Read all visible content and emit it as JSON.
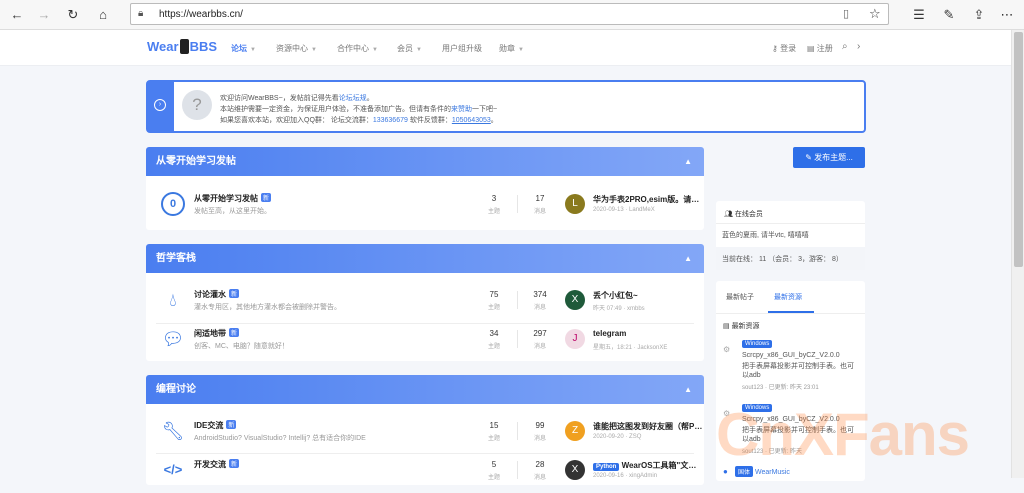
{
  "browser": {
    "url": "https://wearbbs.cn/"
  },
  "logo": {
    "text_a": "Wear",
    "text_b": "BBS"
  },
  "nav": {
    "items": [
      {
        "label": "论坛",
        "caret": true
      },
      {
        "label": "资源中心",
        "caret": true
      },
      {
        "label": "合作中心",
        "caret": true
      },
      {
        "label": "会员",
        "caret": true
      },
      {
        "label": "用户组升级",
        "caret": false
      },
      {
        "label": "勋章",
        "caret": true
      }
    ],
    "login": "登录",
    "register": "注册"
  },
  "notice": {
    "line1_a": "欢迎访问WearBBS~，发帖前记得先看",
    "line1_link": "论坛坛规",
    "line1_b": "。",
    "line2_a": "本站维护需要一定资金，为保证用户体验，不准备添加广告。但请有条件的",
    "line2_link": "来赞助",
    "line2_b": "一下吧~",
    "line3_a": "如果您喜欢本站，欢迎加入QQ群：  论坛交流群：",
    "line3_link1": "133636679",
    "line3_b": "  软件反馈群：",
    "line3_link2": "1050643053",
    "line3_c": "。"
  },
  "sections": [
    {
      "title": "从零开始学习发帖",
      "forums": [
        {
          "name": "从零开始学习发帖",
          "badge": "新",
          "desc": "发帖至高，从这里开始。",
          "threads": "3",
          "threads_label": "主题",
          "posts": "17",
          "posts_label": "消息",
          "last_title": "华为手表2PRO,esim版。请…",
          "last_meta": "2020-09-13 · LandMeX",
          "avatar": "L"
        }
      ]
    },
    {
      "title": "哲学客栈",
      "forums": [
        {
          "name": "讨论灌水",
          "badge": "新",
          "desc": "灌水专用区，其他地方灌水都会被删除并警告。",
          "threads": "75",
          "threads_label": "主题",
          "posts": "374",
          "posts_label": "消息",
          "last_title": "丢个小红包~",
          "last_meta": "昨天 07:49 · xmbbs",
          "avatar": "X"
        },
        {
          "name": "闲适地带",
          "badge": "新",
          "desc": "创客、MC、电脑？随意就好！",
          "threads": "34",
          "threads_label": "主题",
          "posts": "297",
          "posts_label": "消息",
          "last_title": "telegram",
          "last_meta": "星期五，18:21 · JacksonXE",
          "avatar": "J"
        }
      ]
    },
    {
      "title": "编程讨论",
      "forums": [
        {
          "name": "IDE交流",
          "badge": "新",
          "desc": "AndroidStudio? VisualStudio? Intellij? 总有适合你的IDE",
          "threads": "15",
          "threads_label": "主题",
          "posts": "99",
          "posts_label": "消息",
          "last_title": "谁能把这图发到好友圈（帮P…",
          "last_meta": "2020-09-20 · ZSQ",
          "avatar": "Z"
        },
        {
          "name": "开发交流",
          "badge": "新",
          "desc": "",
          "threads": "5",
          "threads_label": "主题",
          "posts": "28",
          "posts_label": "消息",
          "last_tag": "Python",
          "last_title": "WearOS工具箱\"文…",
          "last_meta": "2020-09-16 · xingAdmin",
          "avatar": "X"
        }
      ]
    }
  ],
  "post_button": "发布主题...",
  "online": {
    "title": "在线会员",
    "members": "蓝色的夏雨, 请半vtc, 嘻嘻嘻",
    "stats": "当前在线： 11 （会员： 3，游客： 8）"
  },
  "latest": {
    "tabs": [
      "最新帖子",
      "最新资源"
    ],
    "active_tab": 1,
    "header": "最新资源",
    "items": [
      {
        "tag": "Windows",
        "title": "Scrcpy_x86_GUI_byCZ_V2.0.0",
        "desc": "把手表屏幕投影并可控制手表。也可以adb",
        "meta": "sout123 · 已更新: 昨天 23:01"
      },
      {
        "tag": "Windows",
        "title": "Scrcpy_x86_GUI_byCZ_V2.0.0",
        "desc": "把手表屏幕投影并可控制手表。也可以adb",
        "meta": "sout123 · 已更新: 昨天"
      },
      {
        "tag": "国体",
        "title": "WearMusic",
        "desc": "",
        "meta": ""
      }
    ]
  },
  "watermark": "CnXFans",
  "colors": {
    "accent": "#4a7ef0",
    "button": "#2e6fe8",
    "link": "#3a78e0"
  }
}
